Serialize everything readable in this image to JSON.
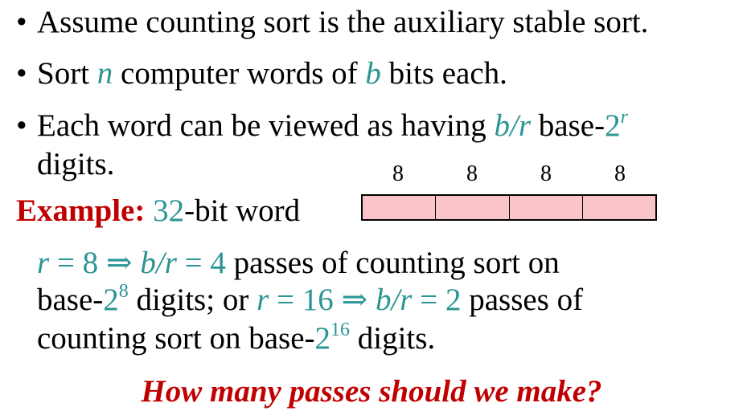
{
  "bullets": [
    {
      "text": "Assume counting sort is the auxiliary stable sort."
    },
    {
      "pre": "Sort ",
      "var_n": "n",
      "mid": " computer words of ",
      "var_b": "b",
      "post": " bits each."
    },
    {
      "pre": "Each word can be viewed as having ",
      "var_br": "b/r",
      "mid": " base-",
      "base_num": "2",
      "base_exp": "r",
      "line2": "digits."
    }
  ],
  "bullet_symbol": "•",
  "example": {
    "label": "Example:",
    "num": "32",
    "text": "-bit word",
    "cell_labels": [
      "8",
      "8",
      "8",
      "8"
    ]
  },
  "explanation": {
    "l1_r": "r",
    "l1_eq1": " = 8 ⇒ ",
    "l1_br": "b/r",
    "l1_eq2": " = 4",
    "l1_text": " passes of counting sort on",
    "l2_text1": "base-",
    "l2_num": "2",
    "l2_exp": "8",
    "l2_text2": " digits; or ",
    "l2_r": "r",
    "l2_eq1": " = 16 ⇒ ",
    "l2_br": "b/r",
    "l2_eq2": " = 2",
    "l2_text3": " passes of",
    "l3_text1": "counting sort on base-",
    "l3_num": "2",
    "l3_exp": "16",
    "l3_text2": " digits."
  },
  "question": "How many passes should we make?",
  "colors": {
    "accent_teal": "#2b9594",
    "accent_red": "#c00000",
    "cell_fill": "#f9c5c8"
  }
}
